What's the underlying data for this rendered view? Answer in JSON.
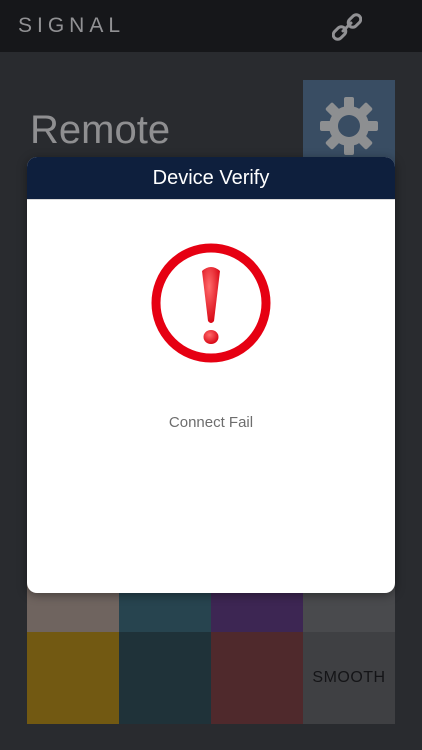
{
  "app": {
    "title": "SIGNAL",
    "link_icon": "link-icon"
  },
  "page": {
    "heading": "Remote",
    "settings_icon": "gear-icon"
  },
  "color_grid": {
    "cells": [
      {
        "color": "#9a8b84",
        "label": ""
      },
      {
        "color": "#365f6e",
        "label": ""
      },
      {
        "color": "#553574",
        "label": ""
      },
      {
        "color": "#66676b",
        "label": ""
      },
      {
        "color": "#9f7c1a",
        "label": ""
      },
      {
        "color": "#2b4650",
        "label": ""
      },
      {
        "color": "#6e3a3e",
        "label": ""
      },
      {
        "color": "#58595d",
        "label": "SMOOTH"
      }
    ]
  },
  "dialog": {
    "title": "Device Verify",
    "icon": "alert-exclamation-icon",
    "message": "Connect Fail",
    "accent_color": "#e60012",
    "header_color": "#0e1f3d"
  }
}
